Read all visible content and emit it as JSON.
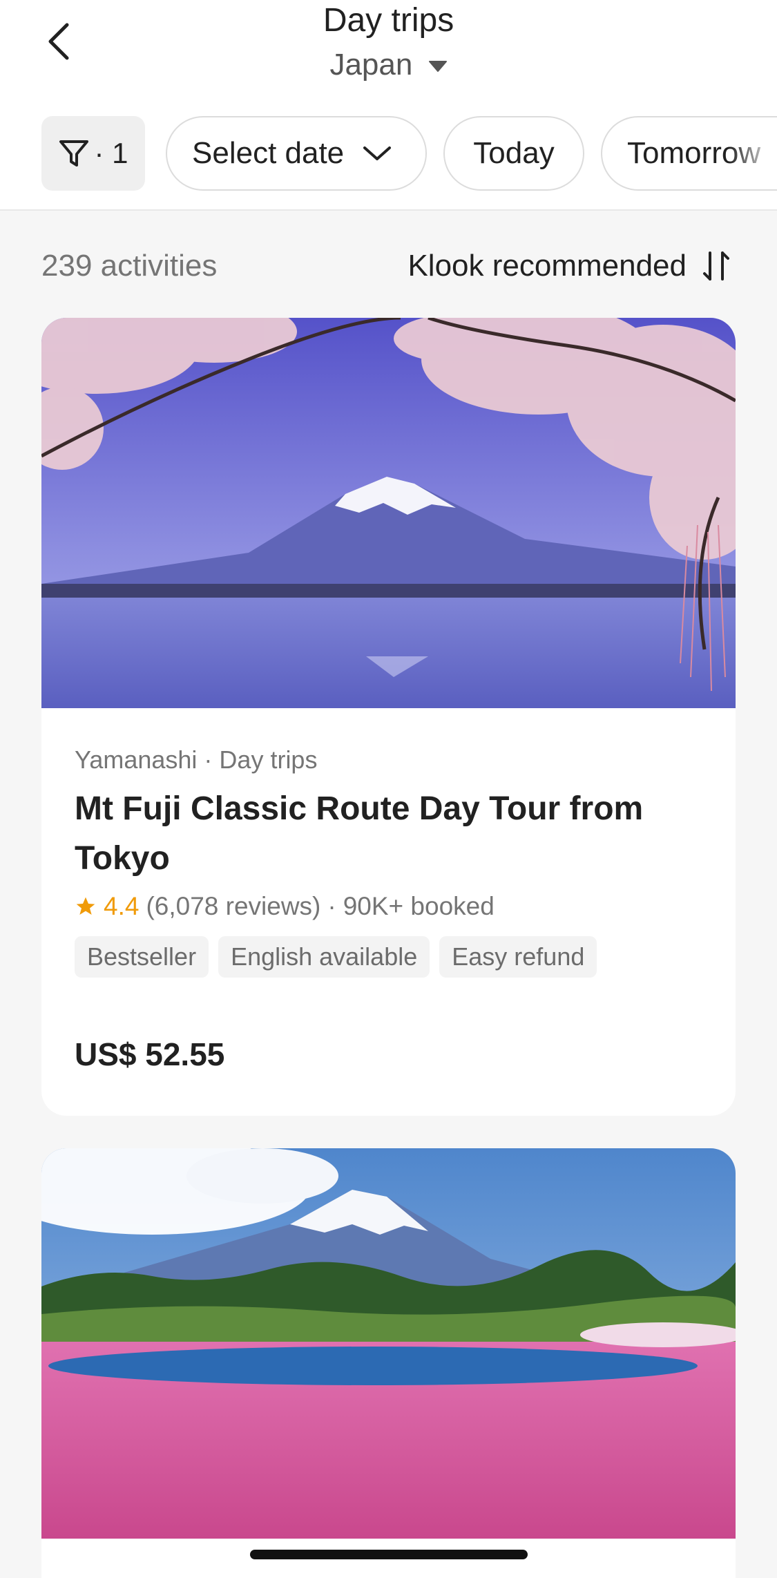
{
  "header": {
    "title": "Day trips",
    "subtitle": "Japan",
    "back_icon": "chevron-left-icon",
    "caret_icon": "caret-down-icon"
  },
  "filters": {
    "filter_count": "· 1",
    "filter_icon": "funnel-icon",
    "chips": [
      "Select date",
      "Today",
      "Tomorrow"
    ],
    "date_chip_icon": "chevron-down-icon"
  },
  "results": {
    "count": "239 activities",
    "sort_label": "Klook recommended",
    "sort_icon": "sort-arrows-icon"
  },
  "activities": [
    {
      "meta": "Yamanashi · Day trips",
      "title": "Mt Fuji Classic Route Day Tour from Tokyo",
      "rating": "4.4",
      "reviews": "(6,078 reviews)",
      "dot": "·",
      "booked": "90K+ booked",
      "tags": [
        "Bestseller",
        "English available",
        "Easy refund"
      ],
      "price": "US$ 52.55",
      "image": "mount-fuji-cherry-blossom-lake-photo"
    },
    {
      "image": "mount-fuji-pink-moss-field-photo"
    }
  ],
  "colors": {
    "accent_star": "#f09b0a",
    "text_primary": "#212121",
    "text_secondary": "#757575",
    "background": "#f6f6f6"
  }
}
